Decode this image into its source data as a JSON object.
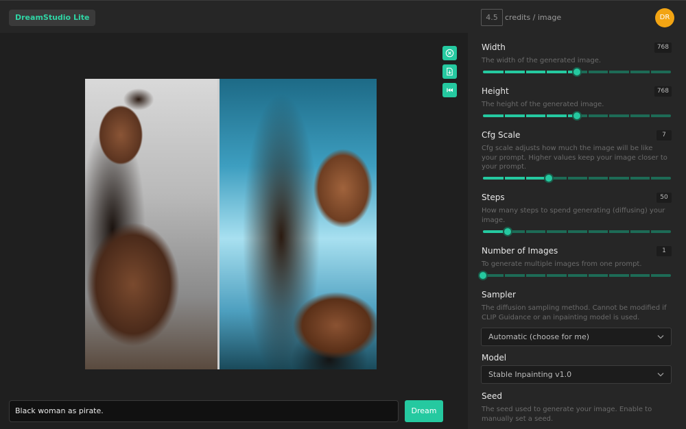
{
  "app": {
    "brand": "DreamStudio Lite"
  },
  "header": {
    "credits_value": "4.5",
    "credits_label": "credits / image",
    "avatar_initials": "DR"
  },
  "tools": {
    "icons": [
      "close-circle-icon",
      "download-icon",
      "skip-back-icon"
    ]
  },
  "prompt": {
    "value": "Black woman as pirate.",
    "dream_label": "Dream"
  },
  "settings": {
    "width": {
      "title": "Width",
      "value": "768",
      "description": "The width of the generated image.",
      "level": 0.5
    },
    "height": {
      "title": "Height",
      "value": "768",
      "description": "The height of the generated image.",
      "level": 0.5
    },
    "cfg": {
      "title": "Cfg Scale",
      "value": "7",
      "description": "Cfg scale adjusts how much the image will be like your prompt. Higher values keep your image closer to your prompt.",
      "level": 0.35
    },
    "steps": {
      "title": "Steps",
      "value": "50",
      "description": "How many steps to spend generating (diffusing) your image.",
      "level": 0.13
    },
    "num_images": {
      "title": "Number of Images",
      "value": "1",
      "description": "To generate multiple images from one prompt.",
      "level": 0.0
    },
    "sampler": {
      "title": "Sampler",
      "description": "The diffusion sampling method. Cannot be modified if CLIP Guidance or an inpainting model is used.",
      "selected": "Automatic (choose for me)"
    },
    "model": {
      "title": "Model",
      "selected": "Stable Inpainting v1.0"
    },
    "seed": {
      "title": "Seed",
      "description": "The seed used to generate your image. Enable to manually set a seed."
    }
  },
  "colors": {
    "accent": "#25c9a0",
    "avatar": "#f2a413",
    "panel": "#262626",
    "background": "#1f1f1f"
  }
}
